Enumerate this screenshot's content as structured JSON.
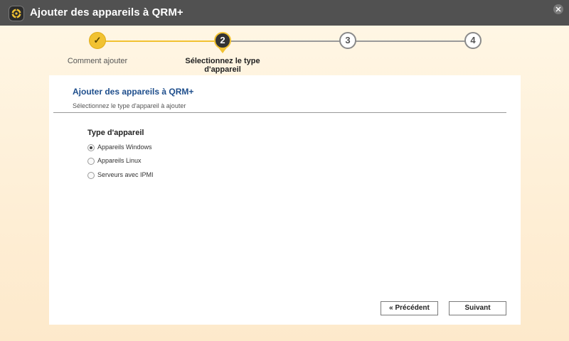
{
  "window": {
    "title": "Ajouter des appareils à QRM+",
    "close_icon": "close-icon",
    "app_icon": "qrm-logo-icon"
  },
  "stepper": {
    "steps": [
      {
        "number": "✓",
        "label": "Comment ajouter",
        "state": "done"
      },
      {
        "number": "2",
        "label": "Sélectionnez le type d'appareil",
        "state": "current"
      },
      {
        "number": "3",
        "label": "",
        "state": "todo"
      },
      {
        "number": "4",
        "label": "",
        "state": "todo"
      }
    ],
    "accent_color": "#f1c232"
  },
  "panel": {
    "title": "Ajouter des appareils à QRM+",
    "subtitle": "Sélectionnez le type d'appareil à ajouter",
    "section_title": "Type d'appareil",
    "options": [
      {
        "label": "Appareils Windows",
        "selected": true
      },
      {
        "label": "Appareils Linux",
        "selected": false
      },
      {
        "label": "Serveurs avec IPMI",
        "selected": false
      }
    ]
  },
  "footer": {
    "prev_label": "« Précédent",
    "next_label": "Suivant"
  }
}
